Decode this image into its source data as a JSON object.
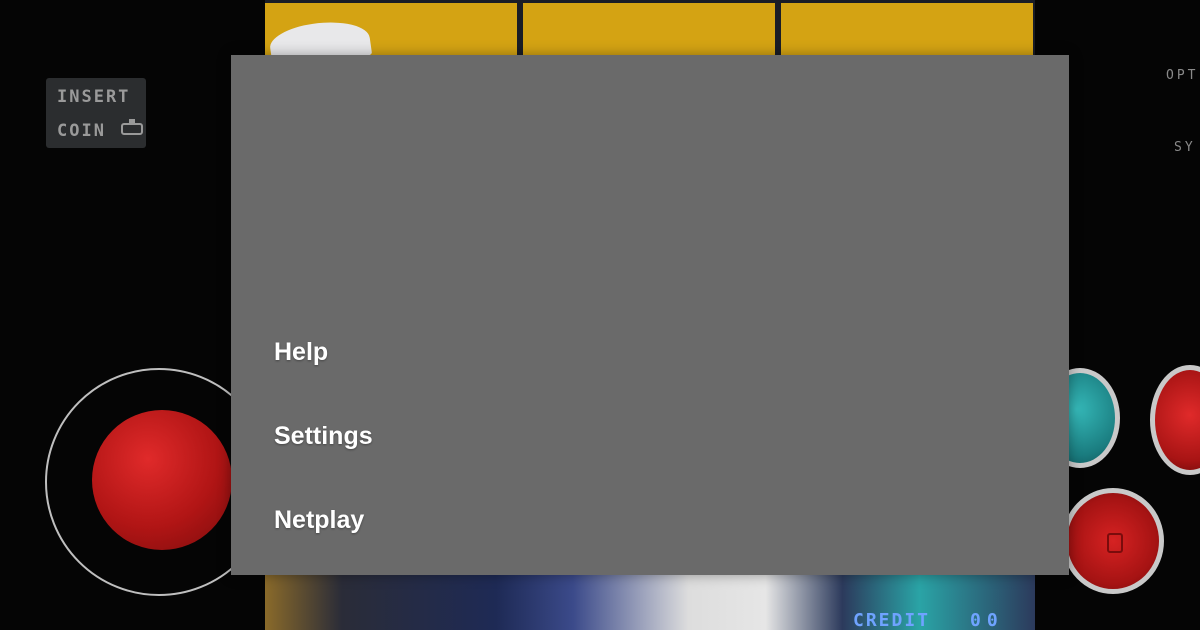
{
  "background": {
    "insert_coin": {
      "line1": "INSERT",
      "line2": "COIN"
    },
    "edge_labels": {
      "options": "OPT",
      "system": "SY"
    },
    "credit": {
      "label": "CREDIT",
      "count": "00"
    }
  },
  "menu": {
    "items": [
      {
        "label": "Help"
      },
      {
        "label": "Settings"
      },
      {
        "label": "Netplay"
      }
    ]
  },
  "colors": {
    "overlay": "#6a6a6a",
    "top_panel": "#d4a313",
    "joystick_ball": "#b11515",
    "button_teal": "#1a7c7f",
    "button_red": "#a81414",
    "credit_text": "#6fa3ff"
  }
}
